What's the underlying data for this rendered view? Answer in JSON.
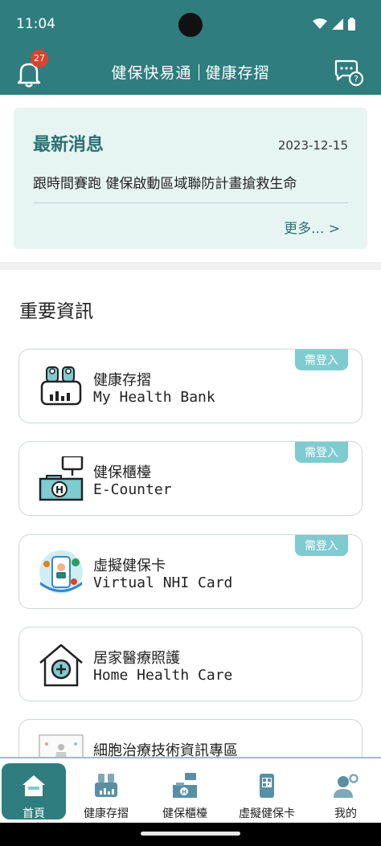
{
  "status_bar": {
    "time": "11:04"
  },
  "app_bar": {
    "title_left": "健保快易通",
    "title_right": "健康存摺",
    "notification_count": "27"
  },
  "news": {
    "heading": "最新消息",
    "date": "2023-12-15",
    "item": "跟時間賽跑 健保啟動區域聯防計畫搶救生命",
    "more": "更多... >"
  },
  "section_title": "重要資訊",
  "cards": [
    {
      "zh": "健康存摺",
      "en": "My Health Bank",
      "tag": "需登入",
      "icon": "health-bank-icon"
    },
    {
      "zh": "健保櫃檯",
      "en": "E-Counter",
      "tag": "需登入",
      "icon": "e-counter-icon"
    },
    {
      "zh": "虛擬健保卡",
      "en": "Virtual NHI Card",
      "tag": "需登入",
      "icon": "virtual-card-icon"
    },
    {
      "zh": "居家醫療照護",
      "en": "Home Health Care",
      "icon": "home-care-icon"
    },
    {
      "zh": "細胞治療技術資訊專區",
      "icon": "cell-therapy-icon"
    }
  ],
  "bottom_nav": [
    {
      "label": "首頁",
      "icon": "home-icon",
      "active": true
    },
    {
      "label": "健康存摺",
      "icon": "health-bank-icon"
    },
    {
      "label": "健保櫃檯",
      "icon": "e-counter-icon"
    },
    {
      "label": "虛擬健保卡",
      "icon": "virtual-card-icon"
    },
    {
      "label": "我的",
      "icon": "profile-icon"
    }
  ],
  "colors": {
    "primary": "#2f7d7e",
    "accent": "#7ecbd0",
    "news_bg": "#e6f4f2",
    "badge": "#d9442b"
  }
}
